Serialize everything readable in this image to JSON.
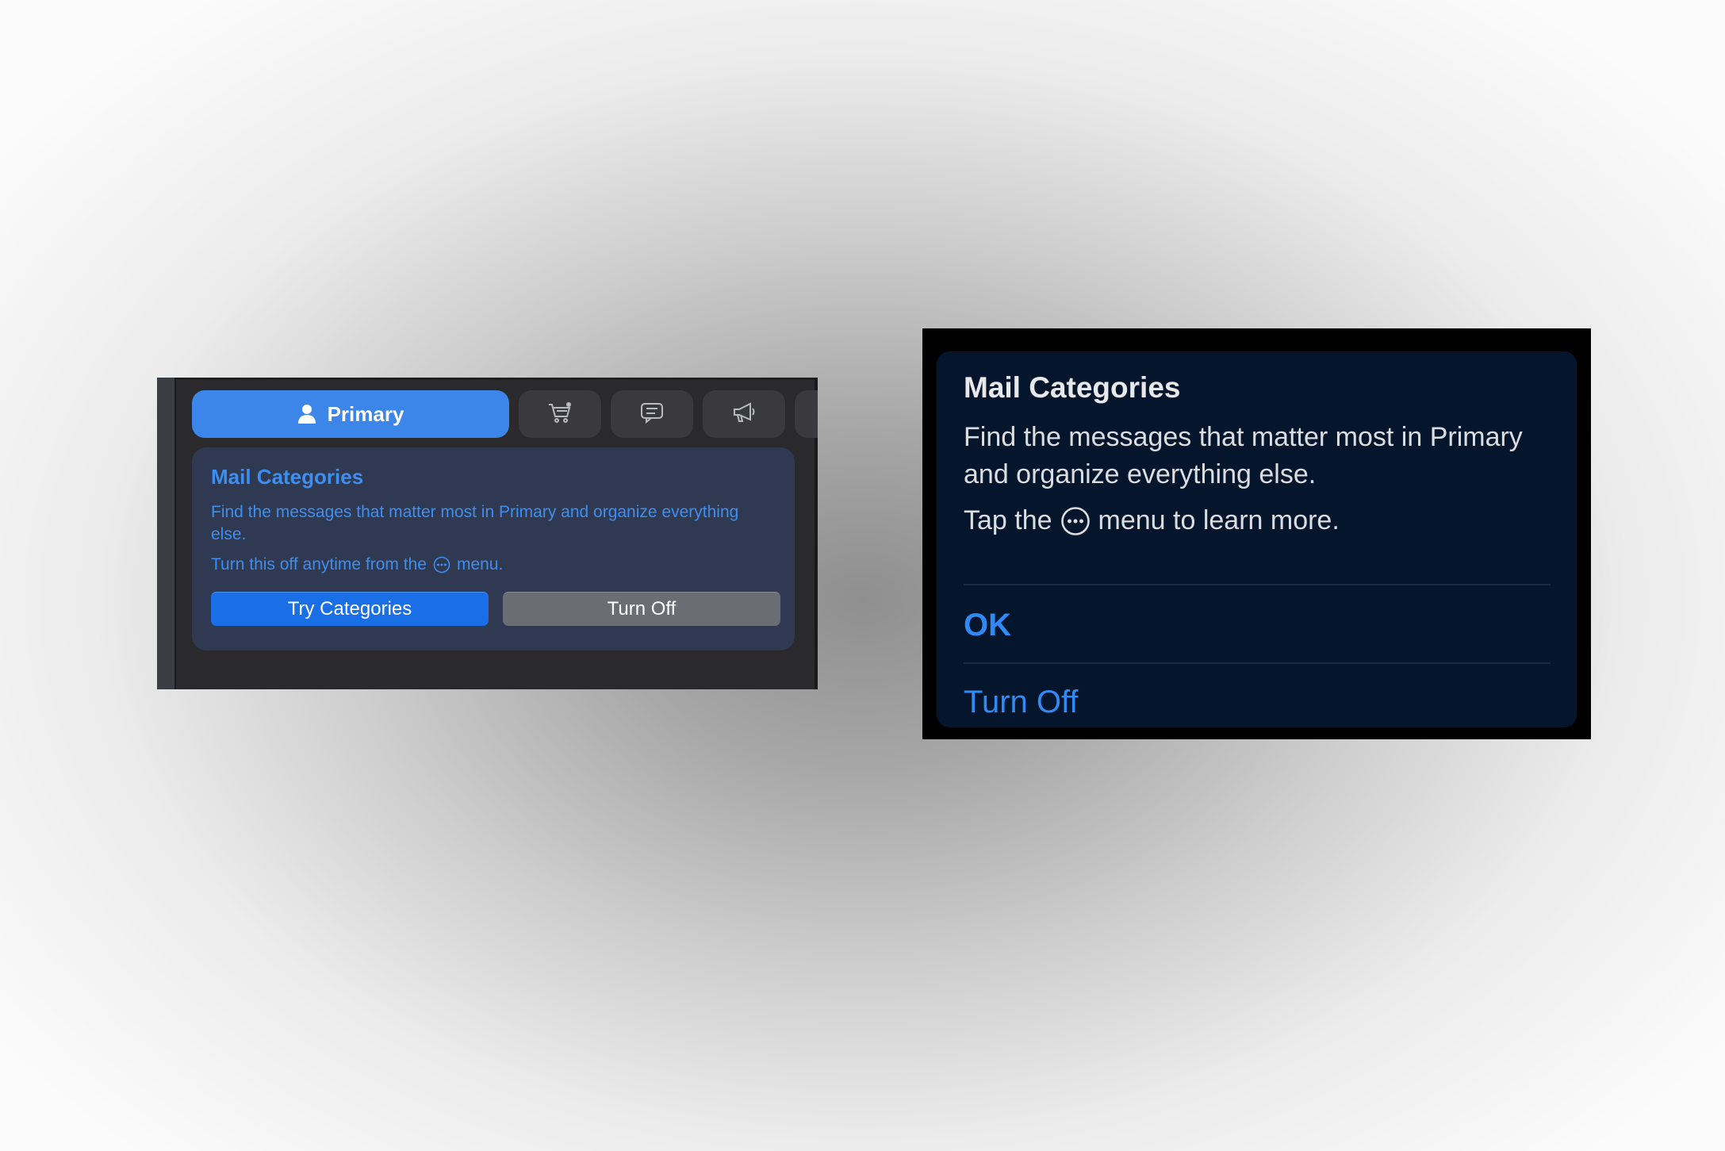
{
  "mac": {
    "tabs": [
      {
        "label": "Primary",
        "icon": "person-icon",
        "selected": true
      },
      {
        "label": "",
        "icon": "cart-icon",
        "selected": false
      },
      {
        "label": "",
        "icon": "chat-bubble-icon",
        "selected": false
      },
      {
        "label": "",
        "icon": "megaphone-icon",
        "selected": false
      }
    ],
    "card": {
      "title": "Mail Categories",
      "body": "Find the messages that matter most in Primary and organize everything else.",
      "hint_before": "Turn this off anytime from the",
      "hint_after": "menu.",
      "try_label": "Try Categories",
      "off_label": "Turn Off"
    }
  },
  "ios": {
    "title": "Mail Categories",
    "body": "Find the messages that matter most in Primary and organize everything else.",
    "hint_before": "Tap the",
    "hint_after": "menu to learn more.",
    "ok_label": "OK",
    "turn_off_label": "Turn Off"
  },
  "colors": {
    "accent": "#3b86e8",
    "mac_card_bg": "#2f3a52",
    "ios_card_bg": "#04152c",
    "ios_link": "#2f8af5"
  }
}
